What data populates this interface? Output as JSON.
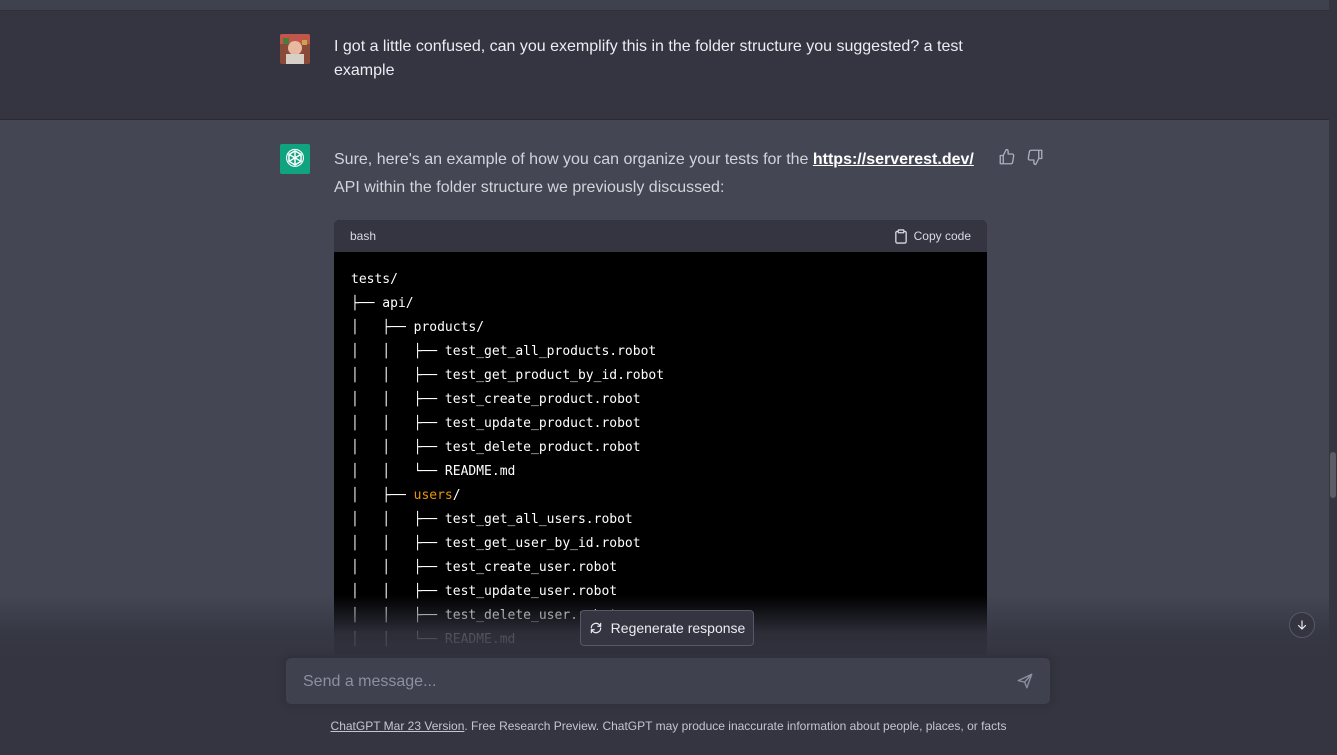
{
  "user_message": {
    "text": "I got a little confused, can you exemplify this in the folder structure you suggested? a test example"
  },
  "assistant_message": {
    "intro_before_link": "Sure, here's an example of how you can organize your tests for the ",
    "link_text": "https://serverest.dev/",
    "intro_after_link": " API within the folder structure we previously discussed:",
    "code_language": "bash",
    "copy_label": "Copy code",
    "code_lines": [
      {
        "pre": "tests/",
        "hl": "",
        "post": ""
      },
      {
        "pre": "├── api/",
        "hl": "",
        "post": ""
      },
      {
        "pre": "│   ├── products/",
        "hl": "",
        "post": ""
      },
      {
        "pre": "│   │   ├── test_get_all_products.robot",
        "hl": "",
        "post": ""
      },
      {
        "pre": "│   │   ├── test_get_product_by_id.robot",
        "hl": "",
        "post": ""
      },
      {
        "pre": "│   │   ├── test_create_product.robot",
        "hl": "",
        "post": ""
      },
      {
        "pre": "│   │   ├── test_update_product.robot",
        "hl": "",
        "post": ""
      },
      {
        "pre": "│   │   ├── test_delete_product.robot",
        "hl": "",
        "post": ""
      },
      {
        "pre": "│   │   └── README.md",
        "hl": "",
        "post": ""
      },
      {
        "pre": "│   ├── ",
        "hl": "users",
        "post": "/"
      },
      {
        "pre": "│   │   ├── test_get_all_users.robot",
        "hl": "",
        "post": ""
      },
      {
        "pre": "│   │   ├── test_get_user_by_id.robot",
        "hl": "",
        "post": ""
      },
      {
        "pre": "│   │   ├── test_create_user.robot",
        "hl": "",
        "post": ""
      },
      {
        "pre": "│   │   ├── test_update_user.robot",
        "hl": "",
        "post": ""
      },
      {
        "pre": "│   │   ├── test_delete_user.robot",
        "hl": "",
        "post": ""
      },
      {
        "pre": "│   │   └── README.md",
        "hl": "",
        "post": ""
      },
      {
        "pre": "│   │",
        "hl": "",
        "post": ""
      }
    ]
  },
  "regenerate_label": "Regenerate response",
  "composer": {
    "placeholder": "Send a message..."
  },
  "footer": {
    "link_text": "ChatGPT Mar 23 Version",
    "rest": ". Free Research Preview. ChatGPT may produce inaccurate information about people, places, or facts"
  },
  "icons": {
    "user_avatar": "user-avatar-image",
    "assistant_avatar": "openai-logo-icon",
    "thumbs_up": "thumbs-up-icon",
    "thumbs_down": "thumbs-down-icon",
    "clipboard": "clipboard-icon",
    "refresh": "refresh-icon",
    "send": "send-icon",
    "scroll_down": "arrow-down-icon"
  },
  "colors": {
    "user_bg": "#343541",
    "assistant_bg": "#444654",
    "accent": "#10a37f",
    "code_highlight": "#e9950c"
  }
}
